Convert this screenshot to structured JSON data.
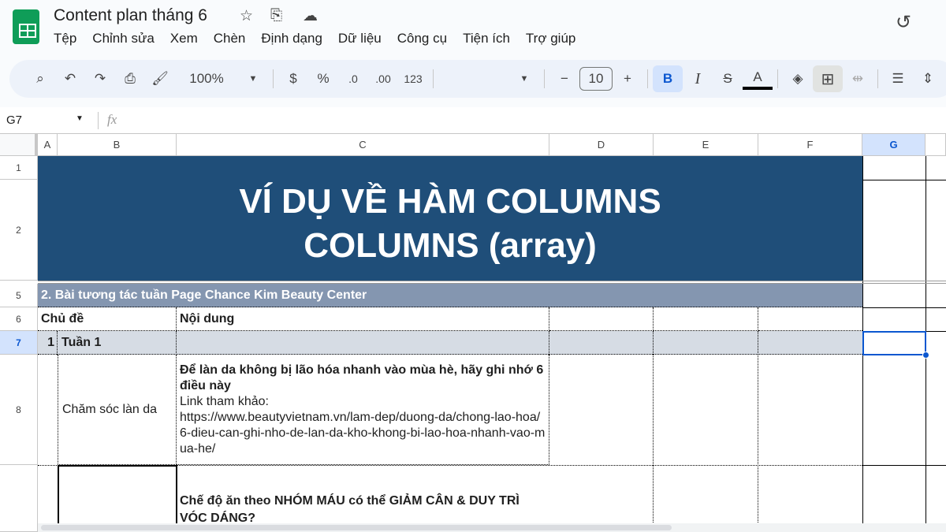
{
  "app": {
    "title": "Content plan tháng 6",
    "icons": [
      "star-icon",
      "move-folder-icon",
      "cloud-status-icon",
      "history-icon"
    ]
  },
  "menu": [
    "Tệp",
    "Chỉnh sửa",
    "Xem",
    "Chèn",
    "Định dạng",
    "Dữ liệu",
    "Công cụ",
    "Tiện ích",
    "Trợ giúp"
  ],
  "toolbar": {
    "zoom": "100%",
    "currency": "$",
    "percent": "%",
    "dec_decrease": ".0",
    "dec_increase": ".00",
    "number_format": "123",
    "font_size": "10",
    "bold": "B",
    "italic": "I",
    "text_color": "A",
    "minus": "−",
    "plus": "+"
  },
  "formula_bar": {
    "cell_ref": "G7",
    "fx": "fx",
    "value": ""
  },
  "columns": [
    "A",
    "B",
    "C",
    "D",
    "E",
    "F",
    "G"
  ],
  "rows": [
    "1",
    "2",
    "5",
    "6",
    "7",
    "8"
  ],
  "sheet": {
    "title_line1": "VÍ DỤ VỀ HÀM COLUMNS",
    "title_line2": "COLUMNS (array)",
    "section": "2. Bài tương tác tuần Page Chance Kim Beauty Center",
    "h_topic": "Chủ đề",
    "h_content": "Nội dung",
    "week_num": "1",
    "week_label": "Tuần 1",
    "r8_topic": "Chăm sóc làn da",
    "r8_title": "Để làn da không bị lão hóa nhanh vào mùa hè, hãy ghi nhớ 6 điều này",
    "r8_link_label": "Link tham khảo:",
    "r8_link": "https://www.beautyvietnam.vn/lam-dep/duong-da/chong-lao-hoa/6-dieu-can-ghi-nho-de-lan-da-kho-khong-bi-lao-hoa-nhanh-vao-mua-he/",
    "r9_title": "Chế độ ăn theo NHÓM MÁU có thể GIẢM CÂN & DUY TRÌ VÓC DÁNG?"
  },
  "colors": {
    "title_bg": "#1f4e79",
    "section_bg": "#8496b0",
    "week_bg": "#d6dce4",
    "selection": "#0b57d0"
  }
}
